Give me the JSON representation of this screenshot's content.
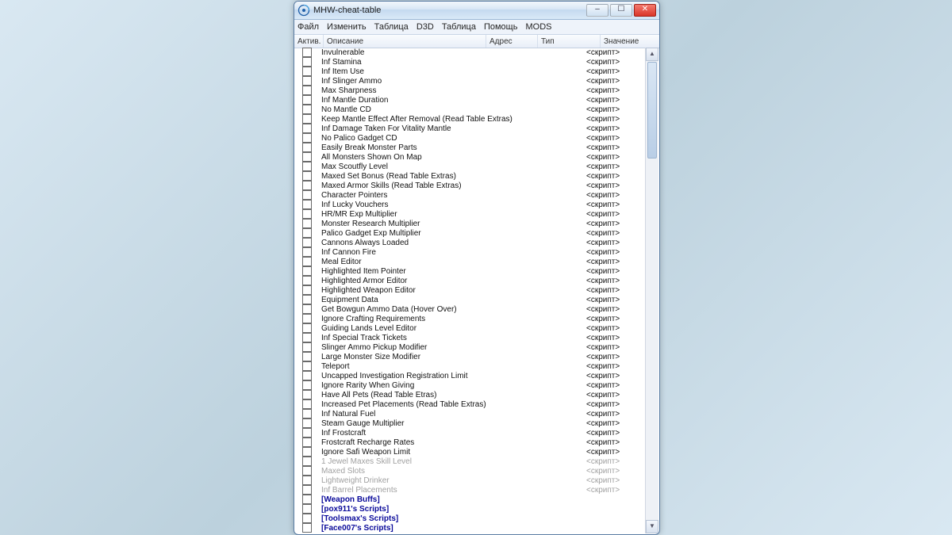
{
  "window_title": "MHW-cheat-table",
  "menubar": [
    "Файл",
    "Изменить",
    "Таблица",
    "D3D",
    "Таблица",
    "Помощь",
    "MODS"
  ],
  "columns": {
    "active": "Актив.",
    "desc": "Описание",
    "addr": "Адрес",
    "type": "Тип",
    "value": "Значение"
  },
  "script_tag": "<скрипт>",
  "rows": [
    {
      "desc": "Invulnerable",
      "value": "<скрипт>",
      "style": "normal"
    },
    {
      "desc": "Inf Stamina",
      "value": "<скрипт>",
      "style": "normal"
    },
    {
      "desc": "Inf Item Use",
      "value": "<скрипт>",
      "style": "normal"
    },
    {
      "desc": "Inf Slinger Ammo",
      "value": "<скрипт>",
      "style": "normal"
    },
    {
      "desc": "Max Sharpness",
      "value": "<скрипт>",
      "style": "normal"
    },
    {
      "desc": "Inf Mantle Duration",
      "value": "<скрипт>",
      "style": "normal"
    },
    {
      "desc": "No Mantle CD",
      "value": "<скрипт>",
      "style": "normal"
    },
    {
      "desc": "Keep Mantle Effect After Removal (Read Table Extras)",
      "value": "<скрипт>",
      "style": "normal"
    },
    {
      "desc": "Inf Damage Taken For Vitality Mantle",
      "value": "<скрипт>",
      "style": "normal"
    },
    {
      "desc": "No Palico Gadget CD",
      "value": "<скрипт>",
      "style": "normal"
    },
    {
      "desc": "Easily Break Monster Parts",
      "value": "<скрипт>",
      "style": "normal"
    },
    {
      "desc": "All Monsters Shown On Map",
      "value": "<скрипт>",
      "style": "normal"
    },
    {
      "desc": "Max Scoutfly Level",
      "value": "<скрипт>",
      "style": "normal"
    },
    {
      "desc": "Maxed Set Bonus (Read Table Extras)",
      "value": "<скрипт>",
      "style": "normal"
    },
    {
      "desc": "Maxed Armor Skills (Read Table Extras)",
      "value": "<скрипт>",
      "style": "normal"
    },
    {
      "desc": "Character Pointers",
      "value": "<скрипт>",
      "style": "normal"
    },
    {
      "desc": "Inf Lucky Vouchers",
      "value": "<скрипт>",
      "style": "normal"
    },
    {
      "desc": "HR/MR Exp Multiplier",
      "value": "<скрипт>",
      "style": "normal"
    },
    {
      "desc": "Monster Research Multiplier",
      "value": "<скрипт>",
      "style": "normal"
    },
    {
      "desc": "Palico Gadget Exp Multiplier",
      "value": "<скрипт>",
      "style": "normal"
    },
    {
      "desc": "Cannons Always Loaded",
      "value": "<скрипт>",
      "style": "normal"
    },
    {
      "desc": "Inf Cannon Fire",
      "value": "<скрипт>",
      "style": "normal"
    },
    {
      "desc": "Meal Editor",
      "value": "<скрипт>",
      "style": "normal"
    },
    {
      "desc": "Highlighted Item Pointer",
      "value": "<скрипт>",
      "style": "normal"
    },
    {
      "desc": "Highlighted Armor Editor",
      "value": "<скрипт>",
      "style": "normal"
    },
    {
      "desc": "Highlighted Weapon Editor",
      "value": "<скрипт>",
      "style": "normal"
    },
    {
      "desc": "Equipment Data",
      "value": "<скрипт>",
      "style": "normal"
    },
    {
      "desc": "Get Bowgun Ammo Data (Hover Over)",
      "value": "<скрипт>",
      "style": "normal"
    },
    {
      "desc": "Ignore Crafting Requirements",
      "value": "<скрипт>",
      "style": "normal"
    },
    {
      "desc": "Guiding Lands Level Editor",
      "value": "<скрипт>",
      "style": "normal"
    },
    {
      "desc": "Inf Special Track Tickets",
      "value": "<скрипт>",
      "style": "normal"
    },
    {
      "desc": "Slinger Ammo Pickup Modifier",
      "value": "<скрипт>",
      "style": "normal"
    },
    {
      "desc": "Large Monster Size Modifier",
      "value": "<скрипт>",
      "style": "normal"
    },
    {
      "desc": "Teleport",
      "value": "<скрипт>",
      "style": "normal"
    },
    {
      "desc": "Uncapped Investigation Registration Limit",
      "value": "<скрипт>",
      "style": "normal"
    },
    {
      "desc": "Ignore Rarity When Giving",
      "value": "<скрипт>",
      "style": "normal"
    },
    {
      "desc": "Have All Pets (Read Table Etras)",
      "value": "<скрипт>",
      "style": "normal"
    },
    {
      "desc": "Increased Pet Placements (Read Table Extras)",
      "value": "<скрипт>",
      "style": "normal"
    },
    {
      "desc": "Inf Natural Fuel",
      "value": "<скрипт>",
      "style": "normal"
    },
    {
      "desc": "Steam Gauge Multiplier",
      "value": "<скрипт>",
      "style": "normal"
    },
    {
      "desc": "Inf Frostcraft",
      "value": "<скрипт>",
      "style": "normal"
    },
    {
      "desc": "Frostcraft Recharge Rates",
      "value": "<скрипт>",
      "style": "normal"
    },
    {
      "desc": "Ignore Safi Weapon Limit",
      "value": "<скрипт>",
      "style": "normal"
    },
    {
      "desc": "1 Jewel Maxes Skill Level",
      "value": "<скрипт>",
      "style": "disabled"
    },
    {
      "desc": "Maxed Slots",
      "value": "<скрипт>",
      "style": "disabled"
    },
    {
      "desc": "Lightweight Drinker",
      "value": "<скрипт>",
      "style": "disabled"
    },
    {
      "desc": "Inf Barrel Placements",
      "value": "<скрипт>",
      "style": "disabled"
    },
    {
      "desc": "[Weapon Buffs]",
      "value": "",
      "style": "bluebold"
    },
    {
      "desc": "[pox911's Scripts]",
      "value": "",
      "style": "bluebold"
    },
    {
      "desc": "[Toolsmax's Scripts]",
      "value": "",
      "style": "bluebold"
    },
    {
      "desc": "[Face007's Scripts]",
      "value": "",
      "style": "bluebold"
    }
  ]
}
